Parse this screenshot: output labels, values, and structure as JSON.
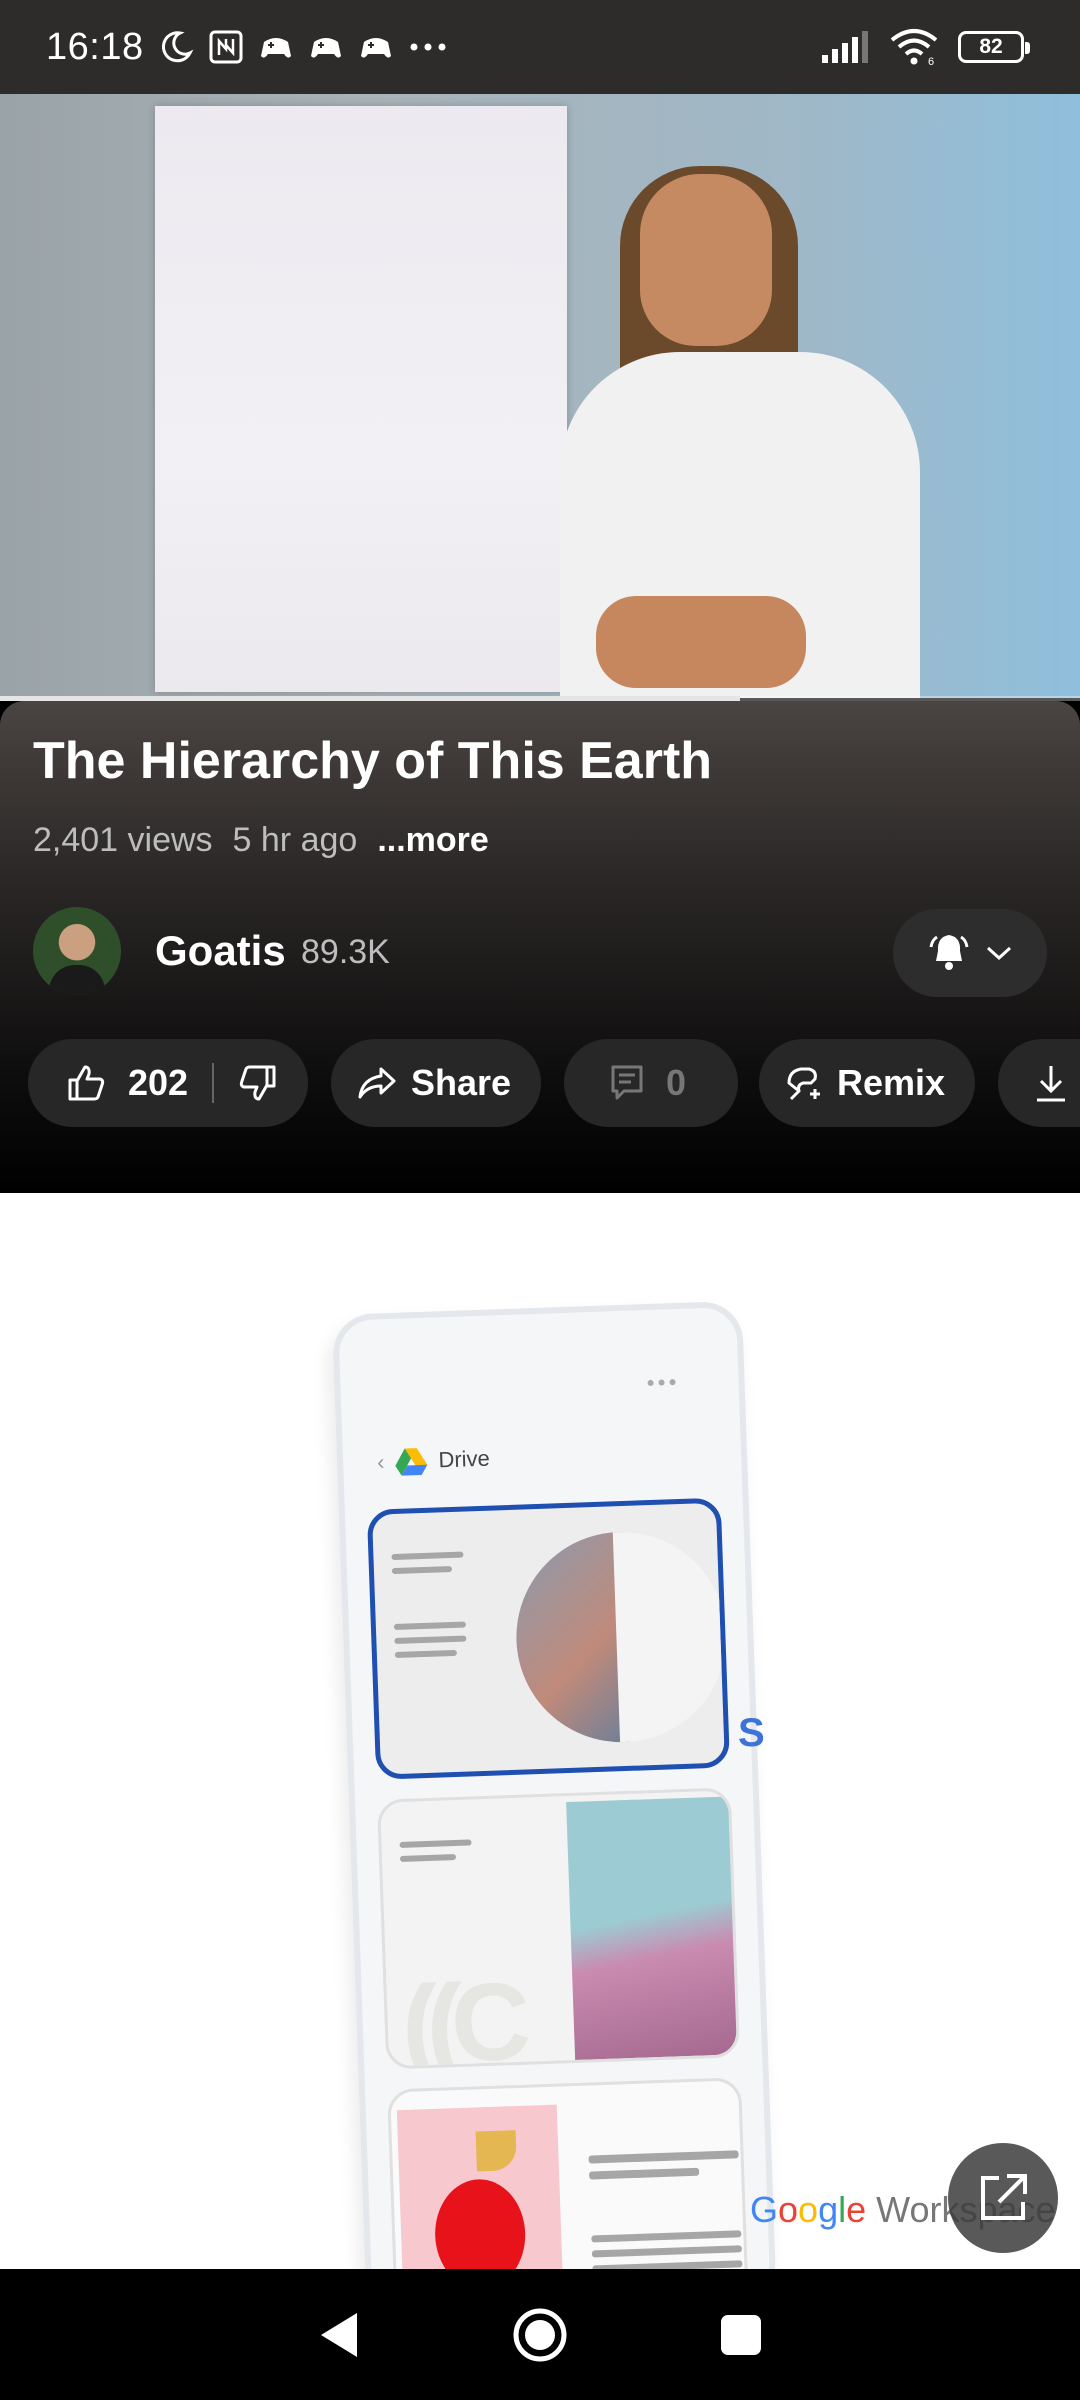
{
  "status_bar": {
    "time": "16:18",
    "battery": "82",
    "signal_strength": "4 of 5 bars",
    "wifi_label": "6"
  },
  "video": {
    "progress": 0.685
  },
  "info": {
    "title": "The Hierarchy of This Earth",
    "views": "2,401 views",
    "age": "5 hr ago",
    "more": "...more"
  },
  "channel": {
    "name": "Goatis",
    "subscribers": "89.3K"
  },
  "actions": {
    "likes": "202",
    "share": "Share",
    "comments": "0",
    "remix": "Remix"
  },
  "ad": {
    "drive_label": "Drive",
    "partial_text": "S",
    "logo": {
      "g1": "G",
      "o1": "o",
      "o2": "o",
      "g2": "g",
      "l": "l",
      "e": "e",
      "suffix": " Workspace"
    }
  },
  "colors": {
    "accent_blue": "#1f4fb1",
    "pill_bg": "#272727"
  }
}
